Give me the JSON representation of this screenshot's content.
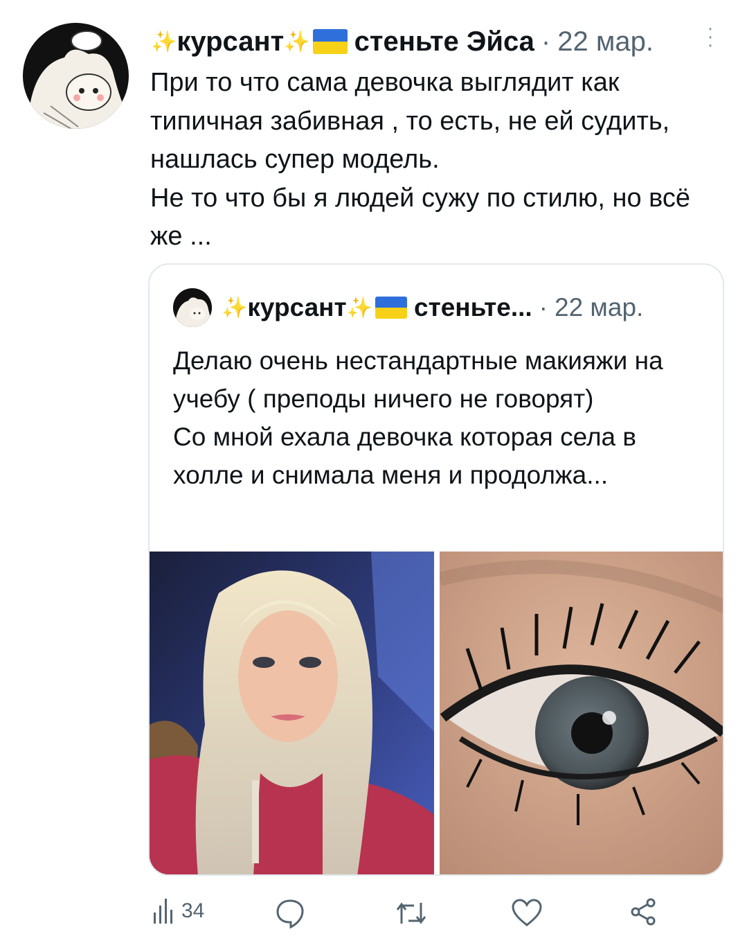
{
  "tweet": {
    "author_name": "курсант",
    "author_handle": "стеньте Эйса",
    "separator": "·",
    "date": "22 мар.",
    "paragraphs": [
      "При то что сама девочка выглядит как типичная забивная , то есть, не ей судить, нашлась супер модель.",
      "Не то что бы я людей сужу по стилю, но всё же ..."
    ]
  },
  "quoted": {
    "author_name": "курсант",
    "author_handle": "стеньте...",
    "separator": "·",
    "date": "22 мар.",
    "paragraphs": [
      "Делаю очень нестандартные макияжи на учебу ( преподы ничего не говорят)",
      "Со мной ехала девочка которая села в холле и снимала меня и продолжа..."
    ],
    "images": [
      "selfie-photo",
      "eye-makeup-photo"
    ]
  },
  "actions": {
    "views_count": "34"
  },
  "colors": {
    "text": "#0f1419",
    "muted": "#536471",
    "border": "#e1e8ed",
    "flag_blue": "#2f6fdc",
    "flag_yellow": "#f7d117"
  }
}
